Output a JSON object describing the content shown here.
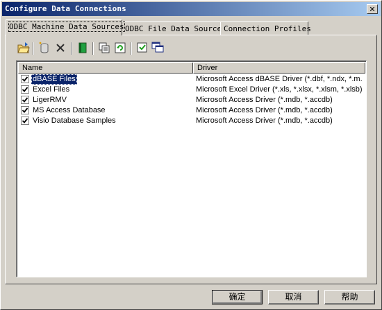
{
  "window": {
    "title": "Configure Data Connections",
    "close_glyph": "✕"
  },
  "tabs": [
    {
      "label": "ODBC Machine Data Sources",
      "active": true
    },
    {
      "label": "ODBC File Data Sources",
      "active": false
    },
    {
      "label": "Connection Profiles",
      "active": false
    }
  ],
  "toolbar": {
    "icons": [
      "open-folder-icon",
      "new-datasource-icon",
      "delete-icon",
      "connect-icon",
      "properties-icon",
      "refresh-icon",
      "check-all-icon",
      "windows-icon"
    ]
  },
  "list": {
    "columns": [
      "Name",
      "Driver"
    ],
    "rows": [
      {
        "name": "dBASE Files",
        "driver": "Microsoft Access dBASE Driver (*.dbf, *.ndx, *.m...",
        "checked": true,
        "selected": true
      },
      {
        "name": "Excel Files",
        "driver": "Microsoft Excel Driver (*.xls, *.xlsx, *.xlsm, *.xlsb)",
        "checked": true,
        "selected": false
      },
      {
        "name": "LigerRMV",
        "driver": "Microsoft Access Driver (*.mdb, *.accdb)",
        "checked": true,
        "selected": false
      },
      {
        "name": "MS Access Database",
        "driver": "Microsoft Access Driver (*.mdb, *.accdb)",
        "checked": true,
        "selected": false
      },
      {
        "name": "Visio Database Samples",
        "driver": "Microsoft Access Driver (*.mdb, *.accdb)",
        "checked": true,
        "selected": false
      }
    ]
  },
  "buttons": {
    "ok": "确定",
    "cancel": "取消",
    "help": "帮助"
  },
  "colors": {
    "titlebar_start": "#0a246a",
    "titlebar_end": "#a6caf0",
    "selection": "#0a246a",
    "face": "#d4d0c8"
  }
}
